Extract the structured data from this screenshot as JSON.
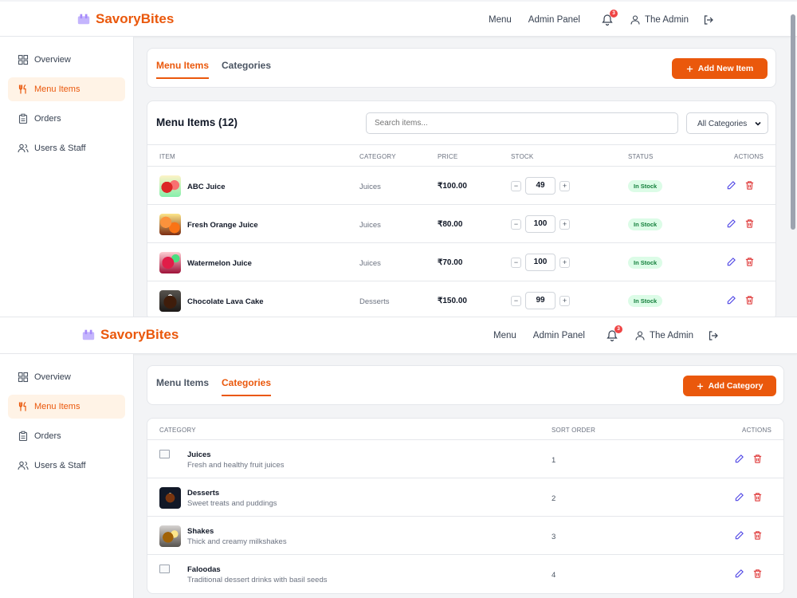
{
  "brand": {
    "name": "SavoryBites"
  },
  "nav": {
    "menu": "Menu",
    "admin_panel": "Admin Panel",
    "notifications": "3",
    "user": "The Admin"
  },
  "sidebar": {
    "items": [
      {
        "label": "Overview"
      },
      {
        "label": "Menu Items"
      },
      {
        "label": "Orders"
      },
      {
        "label": "Users & Staff"
      }
    ]
  },
  "tabs": {
    "menu_items": "Menu Items",
    "categories": "Categories"
  },
  "menu_view": {
    "add_button": "Add New Item",
    "table_title": "Menu Items (12)",
    "search_placeholder": "Search items...",
    "filter_value": "All Categories",
    "columns": {
      "item": "Item",
      "category": "Category",
      "price": "Price",
      "stock": "Stock",
      "status": "Status",
      "actions": "Actions"
    },
    "rows": [
      {
        "name": "ABC Juice",
        "category": "Juices",
        "price": "₹100.00",
        "stock": "49",
        "status": "In Stock"
      },
      {
        "name": "Fresh Orange Juice",
        "category": "Juices",
        "price": "₹80.00",
        "stock": "100",
        "status": "In Stock"
      },
      {
        "name": "Watermelon Juice",
        "category": "Juices",
        "price": "₹70.00",
        "stock": "100",
        "status": "In Stock"
      },
      {
        "name": "Chocolate Lava Cake",
        "category": "Desserts",
        "price": "₹150.00",
        "stock": "99",
        "status": "In Stock"
      }
    ]
  },
  "categories_view": {
    "add_button": "Add Category",
    "columns": {
      "category": "Category",
      "sort_order": "Sort Order",
      "actions": "Actions"
    },
    "rows": [
      {
        "name": "Juices",
        "description": "Fresh and healthy fruit juices",
        "sort_order": "1"
      },
      {
        "name": "Desserts",
        "description": "Sweet treats and puddings",
        "sort_order": "2"
      },
      {
        "name": "Shakes",
        "description": "Thick and creamy milkshakes",
        "sort_order": "3"
      },
      {
        "name": "Faloodas",
        "description": "Traditional dessert drinks with basil seeds",
        "sort_order": "4"
      }
    ]
  },
  "colors": {
    "accent": "#ea580c",
    "in_stock_bg": "#dcfce7",
    "in_stock_text": "#15803d",
    "edit": "#4f46e5",
    "delete": "#dc2626"
  },
  "icons": [
    "utensils-icon",
    "bell-icon",
    "user-icon",
    "logout-icon",
    "grid-icon",
    "fork-knife-icon",
    "clipboard-icon",
    "users-icon",
    "plus-icon",
    "pencil-icon",
    "trash-icon",
    "chevron-down-icon"
  ]
}
